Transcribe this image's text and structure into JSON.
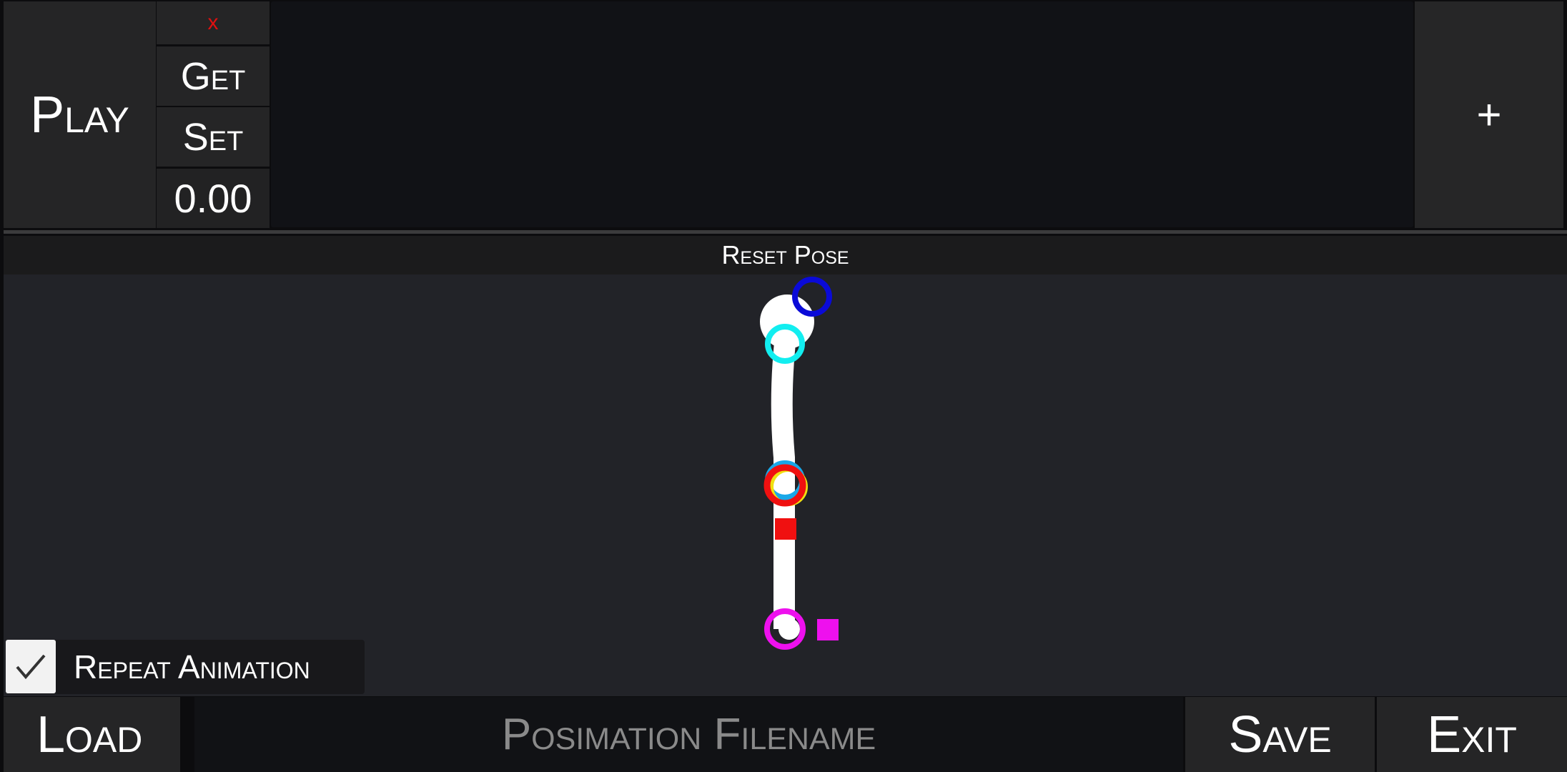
{
  "toolbar": {
    "play_label": "Play",
    "close_label": "x",
    "get_label": "Get",
    "set_label": "Set",
    "time_value": "0.00",
    "add_label": "+"
  },
  "pose": {
    "reset_label": "Reset Pose",
    "handle_colors": {
      "head_target": "#0a0ad8",
      "neck": "#12eef0",
      "hip_back": "#1aa8e8",
      "hip_mid": "#f0e010",
      "hip_front": "#f01010",
      "knee_marker": "#f01010",
      "foot": "#ee10ee",
      "foot_marker": "#ee10ee"
    }
  },
  "options": {
    "repeat_label": "Repeat Animation",
    "repeat_checked": true
  },
  "file": {
    "load_label": "Load",
    "filename_placeholder": "Posimation Filename",
    "filename_value": "",
    "save_label": "Save",
    "exit_label": "Exit"
  }
}
